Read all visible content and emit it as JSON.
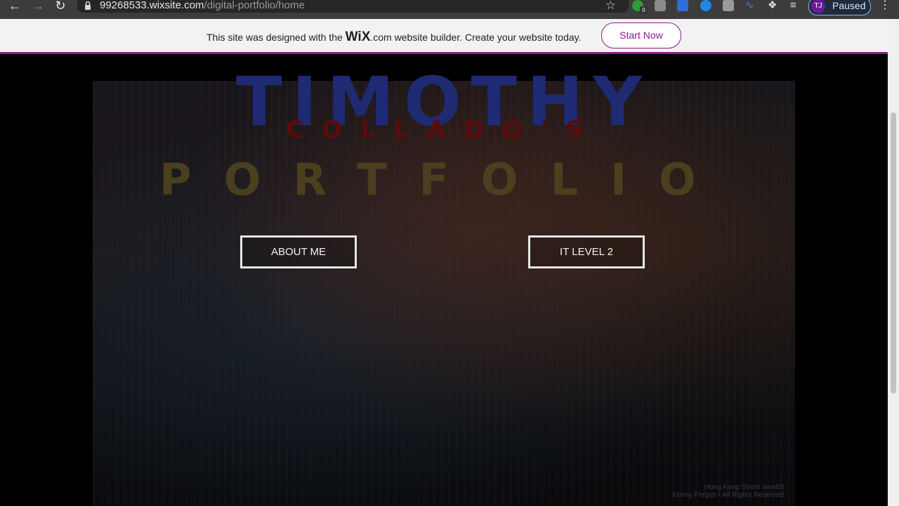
{
  "browser": {
    "url_host": "99268533.wixsite.com",
    "url_path": "/digital-portfolio/home",
    "extension_badge": "0",
    "profile_initials": "TJ",
    "profile_status": "Paused"
  },
  "banner": {
    "text_before": "This site was designed with the ",
    "wix_logo": "WiX",
    "text_after": ".com website builder. Create your website today.",
    "start_button": "Start Now",
    "accent": "#8b1a8b"
  },
  "hero": {
    "title": "TIMOTHY",
    "subtitle": "COLLADO'S",
    "heading": "PORTFOLIO",
    "caption_line1": "Hong Kong Street view03",
    "caption_line2": "Kenny Fergus • All Rights Reserved"
  },
  "buttons": {
    "about": "ABOUT ME",
    "it_level": "IT LEVEL 2"
  },
  "colors": {
    "title": "#1e2a72",
    "subtitle": "#5a0c0c",
    "heading": "#4a3f1e"
  }
}
